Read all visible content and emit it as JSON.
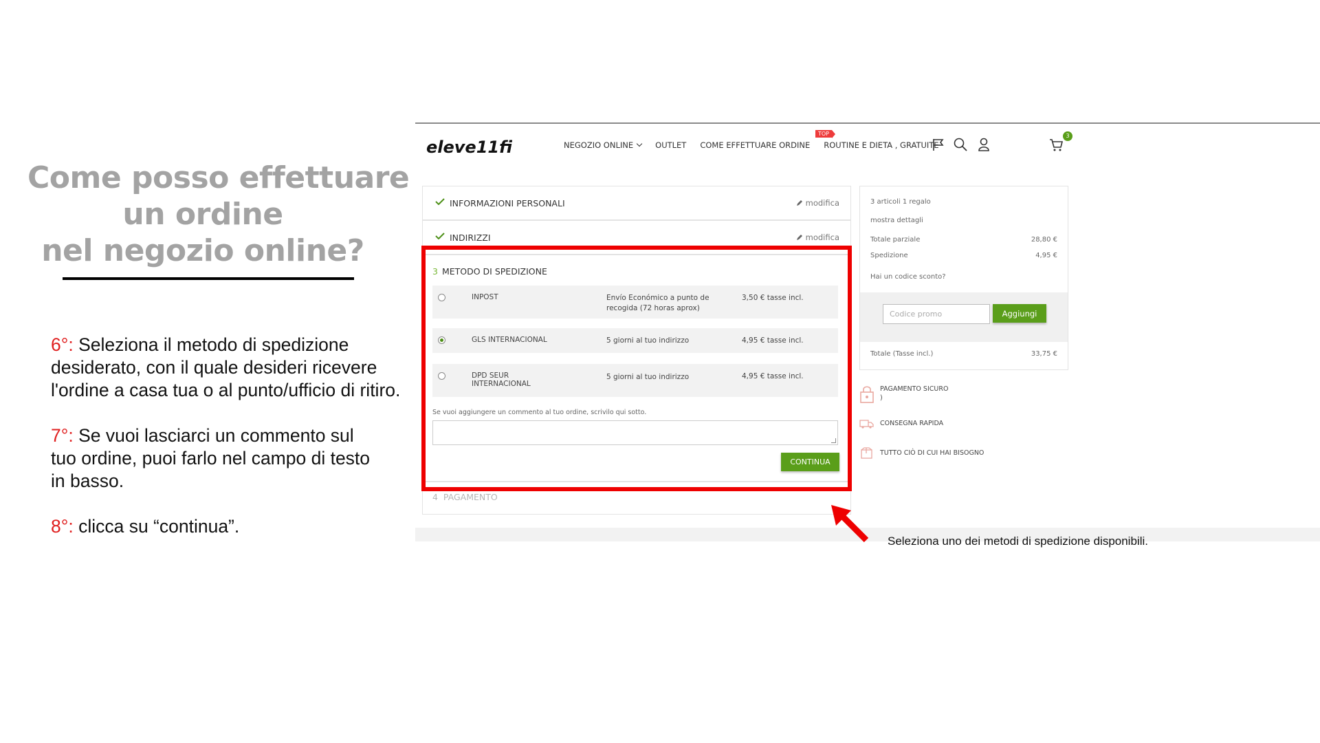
{
  "slide": {
    "title_lines": [
      "Come posso effettuare",
      "un ordine",
      "nel negozio online?"
    ],
    "steps": [
      {
        "num": "6°:",
        "lines": [
          " Seleziona il metodo di spedizione",
          "desiderato, con il quale desideri ricevere",
          "l'ordine a casa tua o al punto/ufficio di ritiro."
        ]
      },
      {
        "num": "7°:",
        "lines": [
          " Se vuoi lasciarci un commento sul",
          "tuo ordine, puoi farlo nel campo di testo",
          "in basso."
        ]
      },
      {
        "num": "8°:",
        "lines": [
          " clicca su “continua”."
        ]
      }
    ],
    "annotation": "Seleziona uno dei metodi di spedizione disponibili."
  },
  "header": {
    "logo_text": "eleve11fit",
    "nav": [
      "NEGOZIO ONLINE",
      "OUTLET",
      "COME EFFETTUARE ORDINE",
      "ROUTINE E DIETA , GRATUITE"
    ],
    "top_badge": "TOP",
    "cart_count": "3",
    "icons": [
      "flag-icon",
      "search-icon",
      "user-icon",
      "cart-icon"
    ]
  },
  "checkout": {
    "step1": {
      "label": "INFORMAZIONI PERSONALI",
      "modify": "modifica"
    },
    "step2": {
      "label": "INDIRIZZI",
      "modify": "modifica"
    },
    "step3": {
      "number": "3",
      "label": "METODO DI SPEDIZIONE",
      "options": [
        {
          "name": "INPOST",
          "desc": "Envío Económico a punto de recogida (72 horas aprox)",
          "price": "3,50 € tasse incl.",
          "selected": false
        },
        {
          "name": "GLS INTERNACIONAL",
          "desc": "5 giorni al tuo indirizzo",
          "price": "4,95 € tasse incl.",
          "selected": true
        },
        {
          "name": "DPD SEUR INTERNACIONAL",
          "desc": "5 giorni al tuo indirizzo",
          "price": "4,95 € tasse incl.",
          "selected": false
        }
      ],
      "comment_label": "Se vuoi aggiungere un commento al tuo ordine, scrivilo qui sotto.",
      "comment_value": "",
      "continue_label": "CONTINUA"
    },
    "step4": {
      "number": "4",
      "label": "PAGAMENTO"
    }
  },
  "summary": {
    "items": "3 articoli 1 regalo",
    "details": "mostra dettagli",
    "subtotal_label": "Totale parziale",
    "subtotal": "28,80 €",
    "shipping_label": "Spedizione",
    "shipping": "4,95 €",
    "promo_question": "Hai un codice sconto?",
    "promo_placeholder": "Codice promo",
    "promo_button": "Aggiungi",
    "total_label": "Totale (Tasse incl.)",
    "total": "33,75 €"
  },
  "perks": [
    {
      "icon": "lock-icon",
      "text": "PAGAMENTO SICURO",
      "text2": ")"
    },
    {
      "icon": "truck-icon",
      "text": "CONSEGNA RAPIDA"
    },
    {
      "icon": "box-icon",
      "text": "TUTTO CIÒ DI CUI HAI BISOGNO"
    }
  ],
  "colors": {
    "accent_green": "#5a9e1a",
    "highlight_red": "#ee0000",
    "title_grey": "#a3a3a3",
    "step_red": "#e02020"
  }
}
